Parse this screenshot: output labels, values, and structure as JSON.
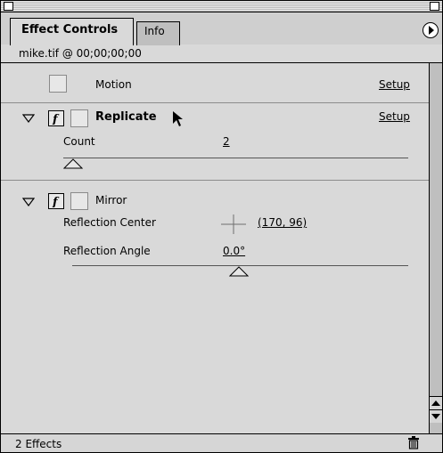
{
  "tabs": [
    {
      "label": "Effect Controls",
      "active": true
    },
    {
      "label": "Info",
      "active": false
    }
  ],
  "clip_label": "mike.tif @ 00;00;00;00",
  "effects": {
    "motion": {
      "name": "Motion",
      "setup_label": "Setup"
    },
    "replicate": {
      "name": "Replicate",
      "setup_label": "Setup",
      "param_label": "Count",
      "param_value": "2"
    },
    "mirror": {
      "name": "Mirror",
      "center_label": "Reflection Center",
      "center_value": "(170, 96)",
      "angle_label": "Reflection Angle",
      "angle_value": "0.0°"
    }
  },
  "status": {
    "text": "2 Effects"
  },
  "icons": [
    "panel-menu-icon",
    "collapse-triangle-icon",
    "effect-f-icon",
    "crosshair-icon",
    "trash-icon",
    "slider-thumb-icon",
    "cursor-arrow-icon"
  ]
}
